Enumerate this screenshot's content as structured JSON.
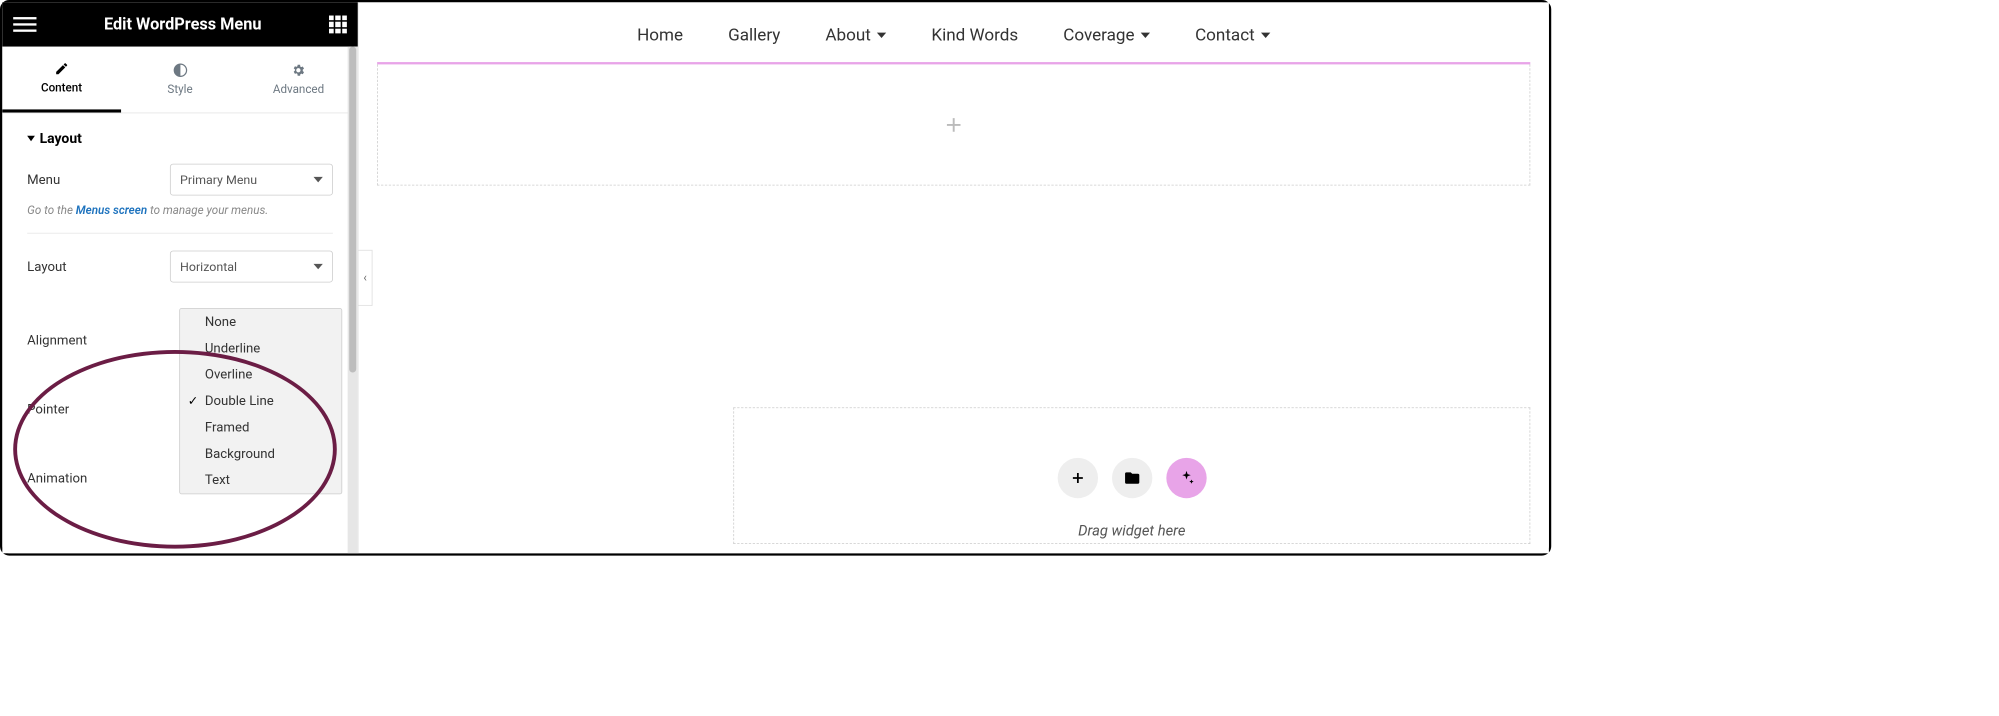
{
  "header": {
    "title": "Edit WordPress Menu"
  },
  "tabs": {
    "content": "Content",
    "style": "Style",
    "advanced": "Advanced",
    "activeIndex": 0
  },
  "section": {
    "title": "Layout"
  },
  "controls": {
    "menu_label": "Menu",
    "menu_value": "Primary Menu",
    "hint_prefix": "Go to the ",
    "hint_link": "Menus screen",
    "hint_suffix": " to manage your menus.",
    "layout_label": "Layout",
    "layout_value": "Horizontal",
    "alignment_label": "Alignment",
    "pointer_label": "Pointer",
    "animation_label": "Animation"
  },
  "pointer_dropdown": {
    "options": [
      "None",
      "Underline",
      "Overline",
      "Double Line",
      "Framed",
      "Background",
      "Text"
    ],
    "selected_index": 3
  },
  "preview": {
    "nav": [
      {
        "label": "Home",
        "dropdown": false
      },
      {
        "label": "Gallery",
        "dropdown": false
      },
      {
        "label": "About",
        "dropdown": true
      },
      {
        "label": "Kind Words",
        "dropdown": false
      },
      {
        "label": "Coverage",
        "dropdown": true
      },
      {
        "label": "Contact",
        "dropdown": true
      }
    ],
    "drop_label": "Drag widget here"
  }
}
